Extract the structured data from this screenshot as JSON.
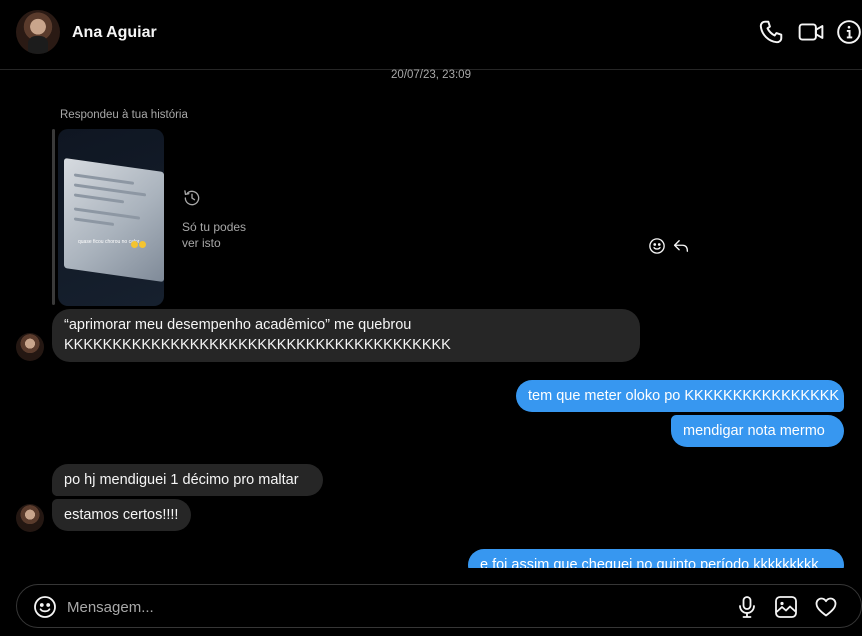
{
  "header": {
    "name": "Ana Aguiar",
    "avatar_icon": "profile-photo",
    "actions": [
      "phone-icon",
      "video-camera-icon",
      "info-icon"
    ]
  },
  "thread": {
    "timestamp": "20/07/23, 23:09",
    "story_reply": {
      "label": "Respondeu à tua história",
      "thumbnail_caption": "quase ficou chorou no calor",
      "only_you_text": "Só tu podes ver isto"
    },
    "messages": [
      {
        "from": "them",
        "text": "“aprimorar meu desempenho acadêmico” me quebrou KKKKKKKKKKKKKKKKKKKKKKKKKKKKKKKKKKKKKKKK"
      },
      {
        "from": "me",
        "text": "tem que meter oloko po KKKKKKKKKKKKKKKK"
      },
      {
        "from": "me",
        "text": "mendigar nota mermo"
      },
      {
        "from": "them",
        "text": "po hj mendiguei 1 décimo pro maltar"
      },
      {
        "from": "them",
        "text": "estamos certos!!!!"
      },
      {
        "from": "me",
        "text": "e foi assim que cheguei no quinto período kkkkkkkkk"
      }
    ]
  },
  "composer": {
    "placeholder": "Mensagem...",
    "icons": [
      "emoji-icon",
      "microphone-icon",
      "image-icon",
      "heart-icon"
    ]
  },
  "colors": {
    "background": "#000000",
    "incoming_bubble": "#262626",
    "outgoing_bubble": "#3797f0",
    "muted_text": "#a8a8a8"
  }
}
